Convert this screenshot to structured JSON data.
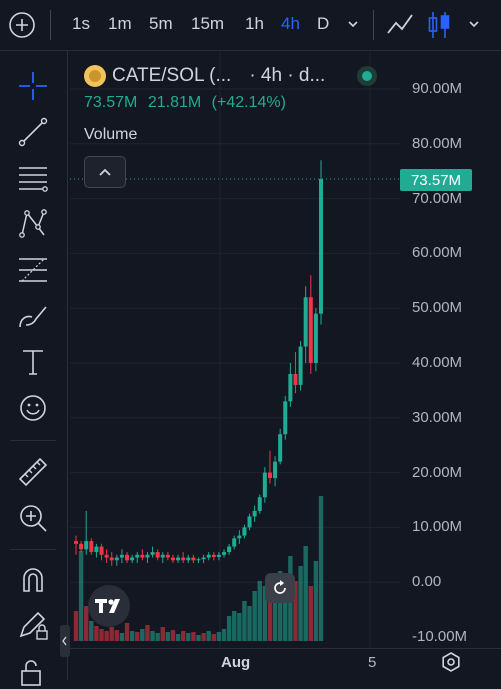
{
  "toolbar": {
    "timeframes": [
      "1s",
      "1m",
      "5m",
      "15m",
      "1h",
      "4h",
      "D"
    ],
    "active_timeframe": "4h"
  },
  "legend": {
    "symbol": "CATE/SOL (...",
    "interval": "· 4h · d...",
    "volume": "73.57M",
    "change": "21.81M",
    "change_pct": "(+42.14%)"
  },
  "indicator": {
    "label": "Volume"
  },
  "price_tag": "73.57M",
  "colors": {
    "up": "#22ab94",
    "down": "#f23645",
    "accent": "#2962ff",
    "bg": "#131722"
  },
  "chart_data": {
    "type": "candlestick",
    "y_axis_labels": [
      "90.00M",
      "80.00M",
      "70.00M",
      "60.00M",
      "50.00M",
      "40.00M",
      "30.00M",
      "20.00M",
      "10.00M",
      "0.00",
      "-10.00M"
    ],
    "ylim": [
      -10,
      90
    ],
    "x_labels": [
      "Aug",
      "5"
    ],
    "last_value": 73.57,
    "candles": [
      [
        7.5,
        8.5,
        5.0,
        7.0
      ],
      [
        7.0,
        7.5,
        5.5,
        6.0
      ],
      [
        6.0,
        13.0,
        5.0,
        7.5
      ],
      [
        7.5,
        8.0,
        5.0,
        5.5
      ],
      [
        5.5,
        7.0,
        4.5,
        6.5
      ],
      [
        6.5,
        7.0,
        4.0,
        5.0
      ],
      [
        5.0,
        6.0,
        3.5,
        4.5
      ],
      [
        4.5,
        5.5,
        3.0,
        4.0
      ],
      [
        4.0,
        5.0,
        3.0,
        4.5
      ],
      [
        4.5,
        6.0,
        3.5,
        5.0
      ],
      [
        5.0,
        5.5,
        3.5,
        4.0
      ],
      [
        4.0,
        5.0,
        3.5,
        4.5
      ],
      [
        4.5,
        5.5,
        3.5,
        5.0
      ],
      [
        5.0,
        6.0,
        4.0,
        4.5
      ],
      [
        4.5,
        5.5,
        3.5,
        5.0
      ],
      [
        5.0,
        6.5,
        4.5,
        5.5
      ],
      [
        5.5,
        6.0,
        4.0,
        4.5
      ],
      [
        4.5,
        5.5,
        3.5,
        5.0
      ],
      [
        5.0,
        5.5,
        4.0,
        4.5
      ],
      [
        4.5,
        5.0,
        3.5,
        4.0
      ],
      [
        4.0,
        5.0,
        3.5,
        4.5
      ],
      [
        4.5,
        5.5,
        3.5,
        4.0
      ],
      [
        4.0,
        5.0,
        3.5,
        4.5
      ],
      [
        4.5,
        5.0,
        3.5,
        4.0
      ],
      [
        4.0,
        4.5,
        3.5,
        4.2
      ],
      [
        4.2,
        5.0,
        3.5,
        4.5
      ],
      [
        4.5,
        5.5,
        4.0,
        5.0
      ],
      [
        5.0,
        5.5,
        4.0,
        4.6
      ],
      [
        4.6,
        5.5,
        4.0,
        5.0
      ],
      [
        5.0,
        6.0,
        4.5,
        5.5
      ],
      [
        5.5,
        7.0,
        5.0,
        6.5
      ],
      [
        6.5,
        8.5,
        6.0,
        8.0
      ],
      [
        8.0,
        9.5,
        7.0,
        8.5
      ],
      [
        8.5,
        10.5,
        8.0,
        10.0
      ],
      [
        10.0,
        12.5,
        9.5,
        12.0
      ],
      [
        12.0,
        14.0,
        11.0,
        13.0
      ],
      [
        13.0,
        16.0,
        12.5,
        15.5
      ],
      [
        15.5,
        21.0,
        14.5,
        20.0
      ],
      [
        20.0,
        24.0,
        18.0,
        19.0
      ],
      [
        19.0,
        23.0,
        17.5,
        22.0
      ],
      [
        22.0,
        28.0,
        21.5,
        27.0
      ],
      [
        27.0,
        34.0,
        26.0,
        33.0
      ],
      [
        33.0,
        40.0,
        32.0,
        38.0
      ],
      [
        38.0,
        42.0,
        34.5,
        36.0
      ],
      [
        36.0,
        44.0,
        35.0,
        43.0
      ],
      [
        43.0,
        54.0,
        40.0,
        52.0
      ],
      [
        52.0,
        56.0,
        38.0,
        40.0
      ],
      [
        40.0,
        50.0,
        38.5,
        49.0
      ],
      [
        49.0,
        77.0,
        47.0,
        73.57
      ]
    ],
    "volumes": [
      [
        30,
        "down"
      ],
      [
        90,
        "up"
      ],
      [
        35,
        "down"
      ],
      [
        20,
        "up"
      ],
      [
        15,
        "down"
      ],
      [
        12,
        "down"
      ],
      [
        10,
        "down"
      ],
      [
        14,
        "down"
      ],
      [
        11,
        "down"
      ],
      [
        8,
        "up"
      ],
      [
        18,
        "down"
      ],
      [
        10,
        "up"
      ],
      [
        9,
        "down"
      ],
      [
        12,
        "up"
      ],
      [
        16,
        "down"
      ],
      [
        10,
        "up"
      ],
      [
        8,
        "up"
      ],
      [
        14,
        "down"
      ],
      [
        9,
        "up"
      ],
      [
        11,
        "down"
      ],
      [
        7,
        "up"
      ],
      [
        10,
        "down"
      ],
      [
        8,
        "up"
      ],
      [
        9,
        "down"
      ],
      [
        6,
        "up"
      ],
      [
        8,
        "down"
      ],
      [
        10,
        "up"
      ],
      [
        7,
        "down"
      ],
      [
        9,
        "up"
      ],
      [
        12,
        "up"
      ],
      [
        25,
        "up"
      ],
      [
        30,
        "up"
      ],
      [
        28,
        "up"
      ],
      [
        40,
        "up"
      ],
      [
        35,
        "up"
      ],
      [
        50,
        "up"
      ],
      [
        60,
        "up"
      ],
      [
        55,
        "up"
      ],
      [
        45,
        "down"
      ],
      [
        40,
        "up"
      ],
      [
        70,
        "up"
      ],
      [
        65,
        "up"
      ],
      [
        85,
        "up"
      ],
      [
        60,
        "down"
      ],
      [
        75,
        "up"
      ],
      [
        95,
        "up"
      ],
      [
        55,
        "down"
      ],
      [
        80,
        "up"
      ],
      [
        145,
        "up"
      ]
    ]
  }
}
